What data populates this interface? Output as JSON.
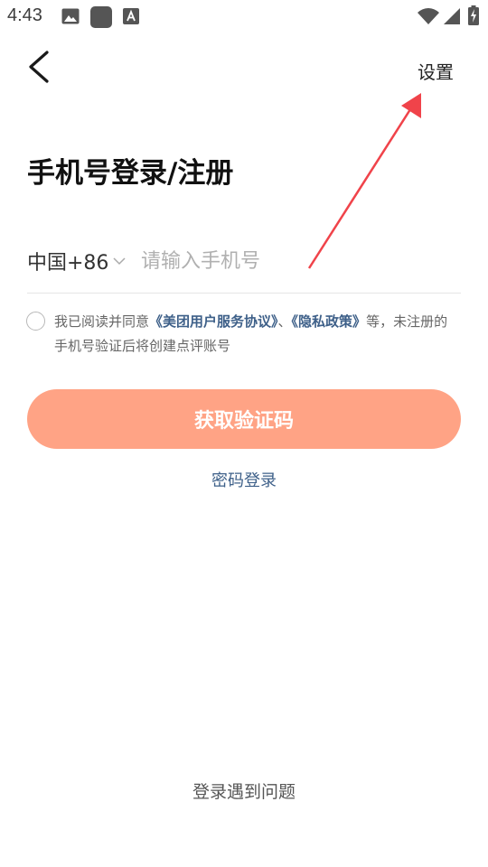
{
  "status_bar": {
    "time": "4:43",
    "icons": [
      "image-icon",
      "app-icon",
      "font-icon",
      "wifi-icon",
      "signal-icon",
      "battery-charging-icon"
    ]
  },
  "header": {
    "back_icon": "chevron-left-icon",
    "settings_label": "设置"
  },
  "page": {
    "title": "手机号登录/注册"
  },
  "phone_form": {
    "country_code": "中国+86",
    "phone_placeholder": "请输入手机号",
    "phone_value": ""
  },
  "agreement": {
    "checked": false,
    "prefix": "我已阅读并同意",
    "link1": "《美团用户服务协议》",
    "separator": "、",
    "link2": "《隐私政策》",
    "suffix": "等，未注册的手机号验证后将创建点评账号"
  },
  "actions": {
    "get_code_label": "获取验证码",
    "password_login_label": "密码登录",
    "help_label": "登录遇到问题"
  },
  "colors": {
    "primary_button": "#ffa385",
    "link": "#3e6089",
    "annotation_arrow": "#f0434a"
  }
}
